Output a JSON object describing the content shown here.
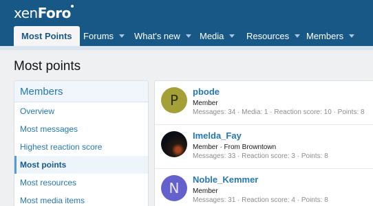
{
  "header": {
    "logo_main": "xen",
    "logo_bold": "Foro"
  },
  "nav": {
    "tabs": [
      {
        "label": "Most Points",
        "active": true
      },
      {
        "label": "Forums",
        "dropdown": true
      },
      {
        "label": "What's new",
        "dropdown": true
      },
      {
        "label": "Media",
        "dropdown": true
      },
      {
        "label": "Resources",
        "dropdown": true
      },
      {
        "label": "Members",
        "dropdown": true
      }
    ]
  },
  "page": {
    "title": "Most points"
  },
  "sidebar": {
    "title": "Members",
    "items": [
      {
        "label": "Overview"
      },
      {
        "label": "Most messages"
      },
      {
        "label": "Highest reaction score"
      },
      {
        "label": "Most points",
        "selected": true
      },
      {
        "label": "Most resources"
      },
      {
        "label": "Most media items"
      }
    ]
  },
  "members": [
    {
      "initial": "P",
      "avatar_color": "#a4a037",
      "initial_color": "#2d2d06",
      "name": "pbode",
      "title": "Member",
      "stats": "Messages: 34 · Media: 1 · Reaction score: 10 · Points: 8"
    },
    {
      "initial": "",
      "name": "Imelda_Fay",
      "title": "Member · From Browntown",
      "stats": "Messages: 33 · Reaction score: 3 · Points: 8"
    },
    {
      "initial": "N",
      "avatar_color": "#6461cc",
      "initial_color": "#e9e8fb",
      "name": "Noble_Kemmer",
      "title": "Member",
      "stats": "Messages: 31 · Reaction score: 4 · Points: 8"
    }
  ]
}
